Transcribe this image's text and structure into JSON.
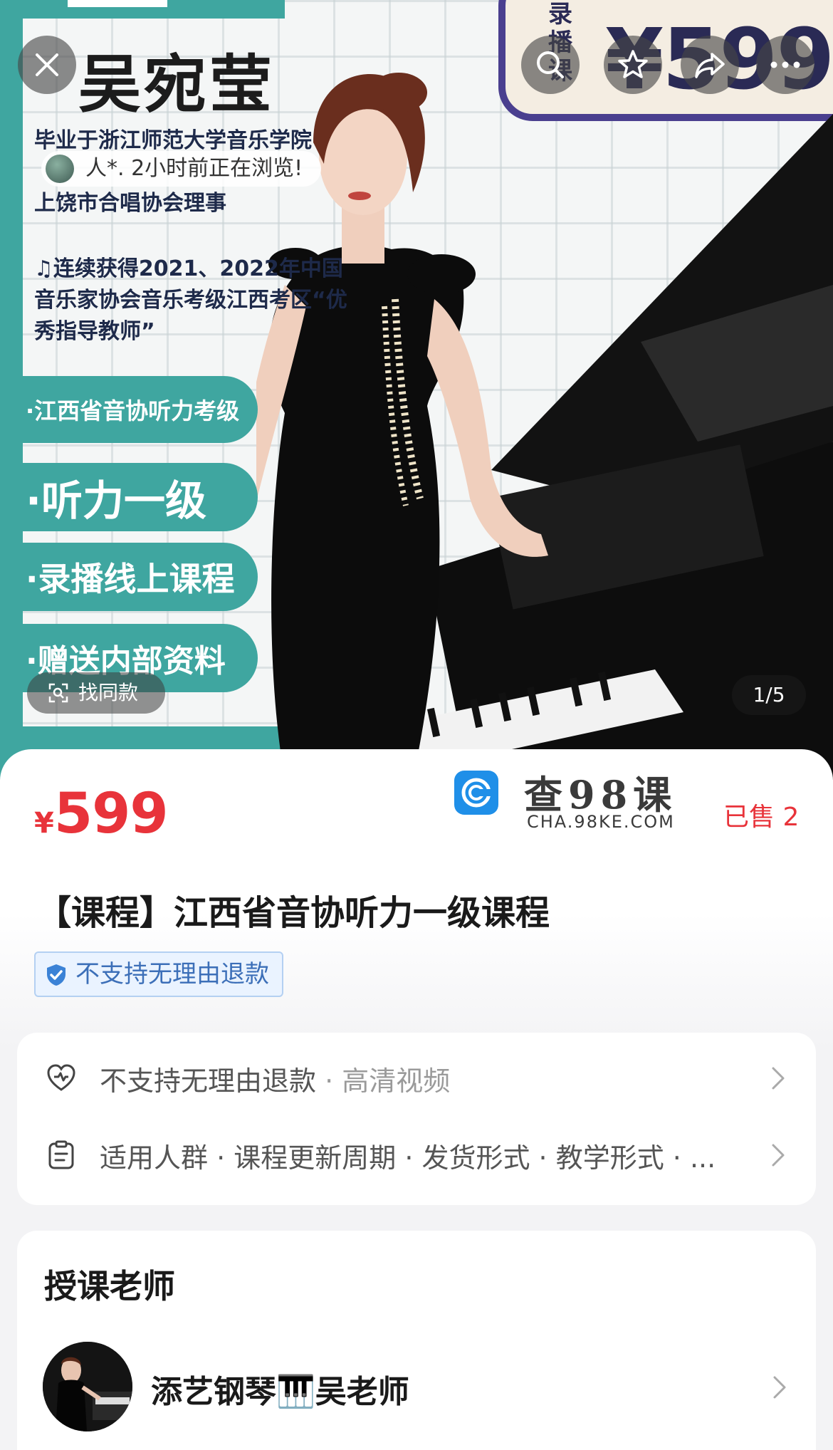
{
  "banner": {
    "teacher_name": "吴宛莹",
    "bio_line1": "毕业于浙江师范大学音乐学院",
    "bio_line2": "上饶市合唱协会理事",
    "bio_line3": "♫连续获得2021、2022年中国音乐家协会音乐考级江西考区“优秀指导教师”",
    "pills": [
      "·江西省音协听力考级",
      "·听力一级",
      "·录播线上课程",
      "·赠送内部资料"
    ],
    "badge_label": "录播课",
    "badge_price": "¥599",
    "viewer_text": "人*. 2小时前正在浏览!",
    "find_similar": "找同款",
    "page_indicator": "1/5"
  },
  "nav": {
    "close_icon": "close-icon",
    "search_icon": "search-icon",
    "favorite_icon": "star-icon",
    "share_icon": "share-icon",
    "more_icon": "more-icon"
  },
  "product": {
    "currency": "¥",
    "price": "599",
    "sold": "已售 2",
    "title": "【课程】江西省音协听力一级课程",
    "refund_tag": "不支持无理由退款"
  },
  "watermark": {
    "title": "查98课",
    "subtitle": "CHA.98KE.COM"
  },
  "services": {
    "row1_main": "不支持无理由退款",
    "row1_rest": " · 高清视频",
    "row2_main": "适用人群 · 课程更新周期 · 发货形式 · 教学形式 · ..."
  },
  "teacher": {
    "heading": "授课老师",
    "name": "添艺钢琴🎹吴老师"
  },
  "colors": {
    "accent_red": "#e8333a",
    "teal": "#3fa6a0",
    "badge_purple": "#4a3f8f"
  }
}
